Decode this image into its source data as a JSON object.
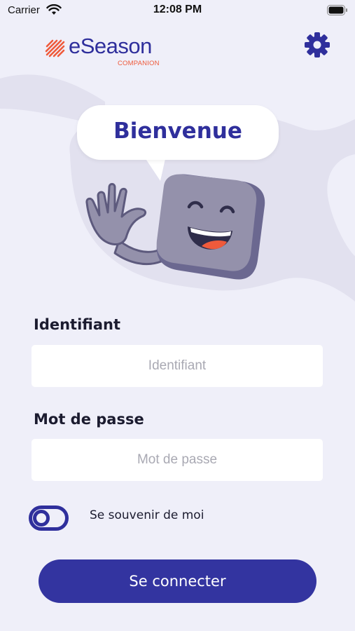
{
  "status_bar": {
    "carrier": "Carrier",
    "time": "12:08 PM",
    "wifi_icon": "wifi-icon",
    "battery_icon": "battery-icon"
  },
  "header": {
    "logo_text": "eSeason",
    "logo_subtitle": "COMPANION",
    "settings_icon": "gear-icon"
  },
  "illustration": {
    "greeting": "Bienvenue",
    "mascot": "waving-mascot-illustration"
  },
  "form": {
    "username": {
      "label": "Identifiant",
      "placeholder": "Identifiant",
      "value": ""
    },
    "password": {
      "label": "Mot de passe",
      "placeholder": "Mot de passe",
      "value": ""
    },
    "remember_me": {
      "label": "Se souvenir de moi",
      "enabled": false
    },
    "submit_label": "Se connecter"
  },
  "colors": {
    "background": "#efeff9",
    "primary": "#3334a0",
    "brand_orange": "#ef5a3b",
    "mascot": "#9491ab"
  }
}
